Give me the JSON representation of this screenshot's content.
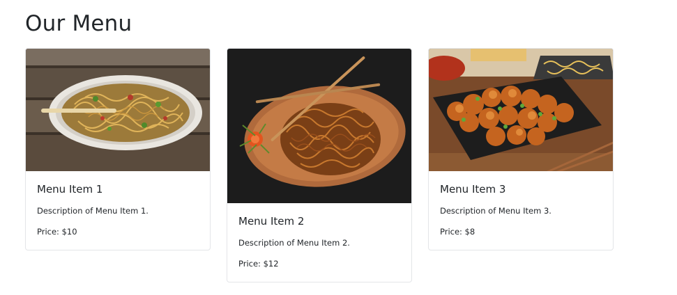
{
  "page": {
    "title": "Our Menu"
  },
  "menu_items": [
    {
      "title": "Menu Item 1",
      "description": "Description of Menu Item 1.",
      "price": "Price: $10",
      "image": "hakka-noodles-photo"
    },
    {
      "title": "Menu Item 2",
      "description": "Description of Menu Item 2.",
      "price": "Price: $12",
      "image": "chow-mein-plate-photo"
    },
    {
      "title": "Menu Item 3",
      "description": "Description of Menu Item 3.",
      "price": "Price: $8",
      "image": "orange-chicken-photo"
    }
  ],
  "colors": {
    "text": "#212529",
    "card_border": "#e3e5e8",
    "background": "#ffffff"
  }
}
